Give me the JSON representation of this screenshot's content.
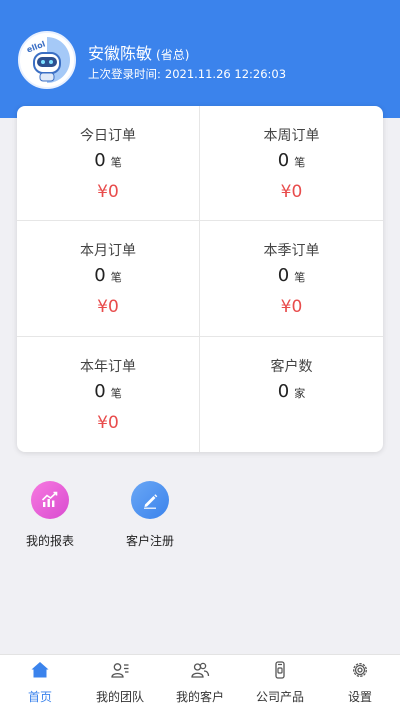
{
  "header": {
    "user_name": "安徽陈敏",
    "user_role": "(省总)",
    "last_login_label": "上次登录时间:",
    "last_login_time": "2021.11.26 12:26:03",
    "avatar_text": "ellol"
  },
  "stats": [
    {
      "title": "今日订单",
      "count": "0",
      "unit": "笔",
      "amount": "¥0"
    },
    {
      "title": "本周订单",
      "count": "0",
      "unit": "笔",
      "amount": "¥0"
    },
    {
      "title": "本月订单",
      "count": "0",
      "unit": "笔",
      "amount": "¥0"
    },
    {
      "title": "本季订单",
      "count": "0",
      "unit": "笔",
      "amount": "¥0"
    },
    {
      "title": "本年订单",
      "count": "0",
      "unit": "笔",
      "amount": "¥0"
    },
    {
      "title": "客户数",
      "count": "0",
      "unit": "家",
      "amount": ""
    }
  ],
  "quick_actions": [
    {
      "label": "我的报表",
      "icon": "chart-trend-icon",
      "color": "#e85ad6"
    },
    {
      "label": "客户注册",
      "icon": "pencil-icon",
      "color": "#3b83ec"
    }
  ],
  "nav": [
    {
      "label": "首页",
      "icon": "home-icon",
      "active": true
    },
    {
      "label": "我的团队",
      "icon": "team-icon",
      "active": false
    },
    {
      "label": "我的客户",
      "icon": "customers-icon",
      "active": false
    },
    {
      "label": "公司产品",
      "icon": "product-icon",
      "active": false
    },
    {
      "label": "设置",
      "icon": "settings-icon",
      "active": false
    }
  ],
  "colors": {
    "primary": "#3b83ec",
    "amount_red": "#e84c4c",
    "background": "#f0f0f4"
  }
}
